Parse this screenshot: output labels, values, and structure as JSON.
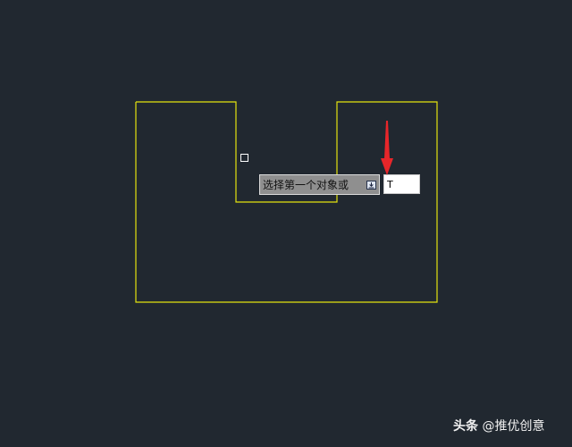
{
  "prompt": {
    "text": "选择第一个对象或",
    "options_icon": "dropdown-arrow-icon"
  },
  "command_input": {
    "value": "T"
  },
  "watermark": {
    "brand": "头条",
    "handle": "@推优创意"
  },
  "colors": {
    "background": "#212830",
    "geometry": "#e3e30f",
    "annotation": "#e8262a",
    "tooltip": "#8f8f8f"
  }
}
